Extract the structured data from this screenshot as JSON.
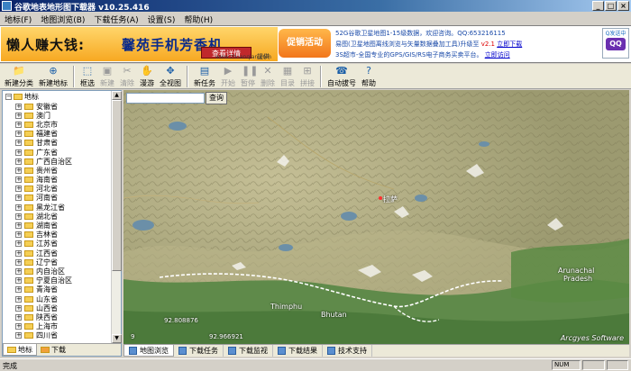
{
  "window": {
    "title": "谷歌地表地形图下载器 v10.25.416",
    "controls": [
      "_",
      "□",
      "×"
    ]
  },
  "menu": [
    {
      "label": "地标(F)"
    },
    {
      "label": "地图浏览(B)"
    },
    {
      "label": "下载任务(A)"
    },
    {
      "label": "设置(S)"
    },
    {
      "label": "帮助(H)"
    }
  ],
  "banner": {
    "ad_line1": "懒人赚大钱:",
    "ad_line2": "馨苑手机芳香机",
    "ad_button": "查看详情",
    "ad_site": "www.zhuanqian.com",
    "ad_note": "提供",
    "promo": "促销活动",
    "info_line1": "52G谷歌卫星地图1-15级数据，欢迎咨询。QQ:653216115",
    "info_line2_a": "易图(卫星地图离线浏览与矢量数据叠加工具)升级至",
    "info_line2_ver": "v2.1",
    "info_line2_link": "立即下载",
    "info_line3_a": "3S超市-全国专业的GPS/GIS/RS电子商务买卖平台。",
    "info_line3_link": "立即访问",
    "qq_title": "Q发送中",
    "qq_logo": "QQ"
  },
  "toolbar": [
    {
      "label": "新建分类",
      "icon": "📁",
      "name": "new-category",
      "enabled": true
    },
    {
      "label": "新建地标",
      "icon": "⊕",
      "name": "new-landmark",
      "enabled": true
    },
    {
      "sep": true
    },
    {
      "label": "框选",
      "icon": "⬚",
      "name": "box-select",
      "enabled": true
    },
    {
      "label": "新建",
      "icon": "▣",
      "name": "new",
      "enabled": false
    },
    {
      "label": "清除",
      "icon": "✂",
      "name": "clear",
      "enabled": false
    },
    {
      "label": "漫游",
      "icon": "✋",
      "name": "pan",
      "enabled": true
    },
    {
      "label": "全视图",
      "icon": "✥",
      "name": "full-view",
      "enabled": true
    },
    {
      "sep": true
    },
    {
      "label": "新任务",
      "icon": "▤",
      "name": "new-task",
      "enabled": true
    },
    {
      "label": "开始",
      "icon": "▶",
      "name": "start",
      "enabled": false
    },
    {
      "label": "暂停",
      "icon": "❚❚",
      "name": "pause",
      "enabled": false
    },
    {
      "label": "删除",
      "icon": "✕",
      "name": "delete",
      "enabled": false
    },
    {
      "label": "目录",
      "icon": "▦",
      "name": "directory",
      "enabled": false
    },
    {
      "label": "拼接",
      "icon": "⊞",
      "name": "stitch",
      "enabled": false
    },
    {
      "sep": true
    },
    {
      "label": "自动拔号",
      "icon": "☎",
      "name": "auto-dial",
      "enabled": true
    },
    {
      "label": "帮助",
      "icon": "?",
      "name": "help",
      "enabled": true
    }
  ],
  "sidebar": {
    "root": "地标",
    "items": [
      "安徽省",
      "澳门",
      "北京市",
      "福建省",
      "甘肃省",
      "广东省",
      "广西自治区",
      "贵州省",
      "海南省",
      "河北省",
      "河南省",
      "黑龙江省",
      "湖北省",
      "湖南省",
      "吉林省",
      "江苏省",
      "江西省",
      "辽宁省",
      "内自治区",
      "宁夏自治区",
      "青海省",
      "山东省",
      "山西省",
      "陕西省",
      "上海市",
      "四川省"
    ],
    "tabs": [
      "地标",
      "下载"
    ]
  },
  "map": {
    "search_placeholder": "",
    "search_button": "查询",
    "labels": {
      "lhasa": "拉萨",
      "thimphu": "Thimphu",
      "bhutan": "Bhutan",
      "arunachal1": "Arunachal",
      "arunachal2": "Pradesh"
    },
    "coords": {
      "a": "92.808876",
      "b": "92.966921",
      "c": "9"
    },
    "watermark": "Arcgyes Software"
  },
  "bottom_tabs": [
    "地图浏览",
    "下载任务",
    "下载监视",
    "下载结果",
    "技术支持"
  ],
  "status": {
    "text": "完成",
    "num": "NUM"
  },
  "colors": {
    "titlebar": "#0a246a",
    "accent": "#1b5fa8",
    "map_terrain": "#a9a578"
  }
}
